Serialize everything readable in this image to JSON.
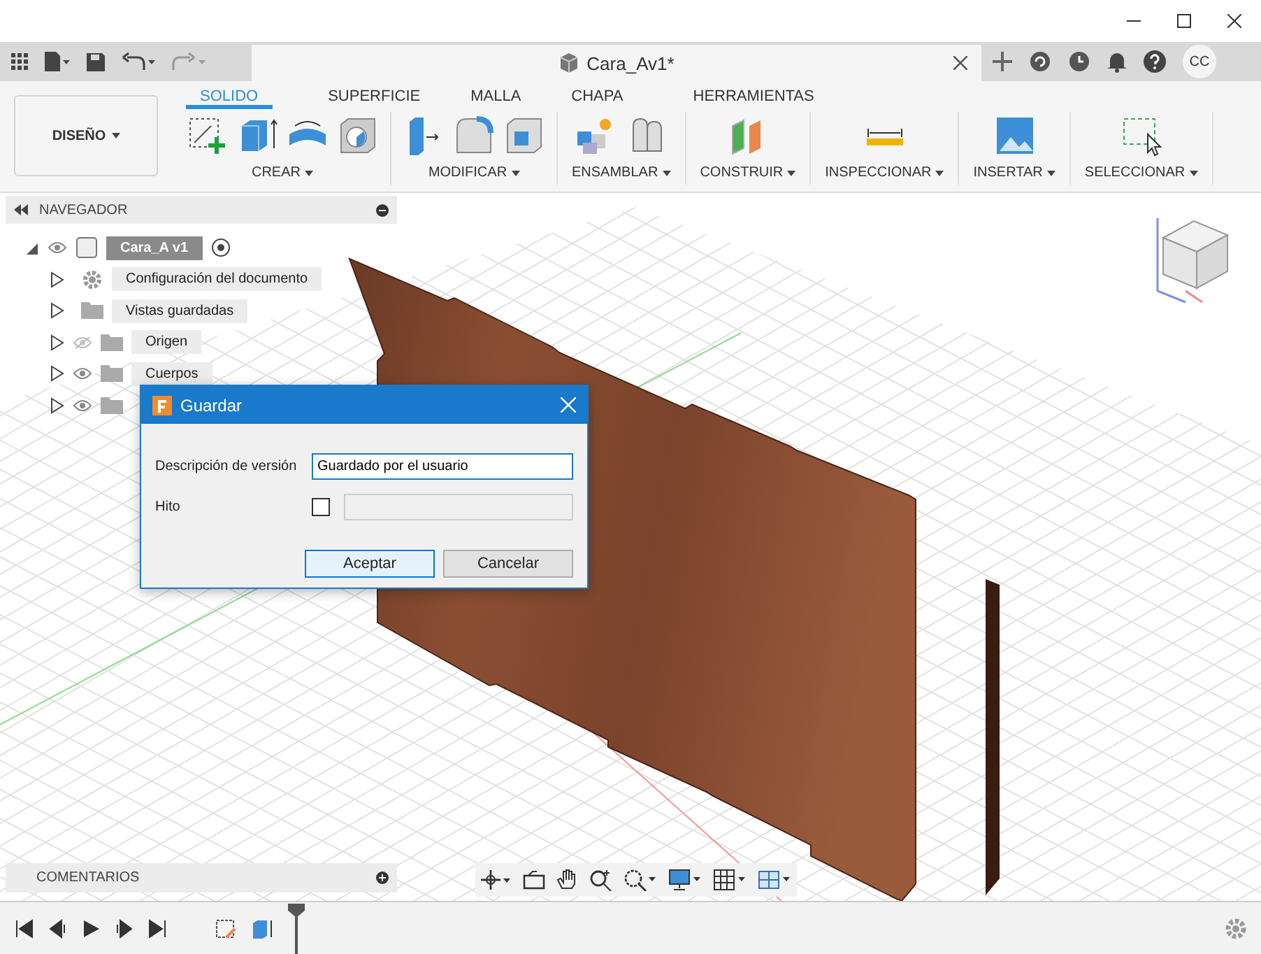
{
  "document_tab": {
    "title": "Cara_Av1*"
  },
  "user": {
    "initials": "CC"
  },
  "workspace": {
    "label": "DISEÑO"
  },
  "toolbar_tabs": [
    {
      "label": "SOLIDO",
      "selected": true
    },
    {
      "label": "SUPERFICIE",
      "selected": false
    },
    {
      "label": "MALLA",
      "selected": false
    },
    {
      "label": "CHAPA",
      "selected": false
    },
    {
      "label": "HERRAMIENTAS",
      "selected": false
    }
  ],
  "tool_groups": [
    {
      "label": "CREAR"
    },
    {
      "label": "MODIFICAR"
    },
    {
      "label": "ENSAMBLAR"
    },
    {
      "label": "CONSTRUIR"
    },
    {
      "label": "INSPECCIONAR"
    },
    {
      "label": "INSERTAR"
    },
    {
      "label": "SELECCIONAR"
    }
  ],
  "browser": {
    "title": "NAVEGADOR",
    "root": {
      "label": "Cara_A v1",
      "selected": true,
      "visible": true,
      "expanded": true,
      "children": [
        {
          "label": "Configuración del documento",
          "selected": false,
          "kind": "settings",
          "expanded": false
        },
        {
          "label": "Vistas guardadas",
          "selected": false,
          "kind": "folder",
          "expanded": false
        },
        {
          "label": "Origen",
          "selected": false,
          "kind": "folder",
          "visible": false,
          "expanded": false
        },
        {
          "label": "Cuerpos",
          "selected": false,
          "kind": "folder",
          "visible": true,
          "expanded": false
        },
        {
          "kind": "folder",
          "visible": true,
          "expanded": false
        }
      ]
    }
  },
  "dialog": {
    "title": "Guardar",
    "description": {
      "label": "Descripción de versión",
      "value": "Guardado por el usuario"
    },
    "milestone": {
      "label": "Hito",
      "checked": false
    },
    "buttons": [
      {
        "label": "Aceptar",
        "default": true
      },
      {
        "label": "Cancelar",
        "default": false
      }
    ]
  },
  "comments": {
    "title": "COMENTARIOS"
  }
}
